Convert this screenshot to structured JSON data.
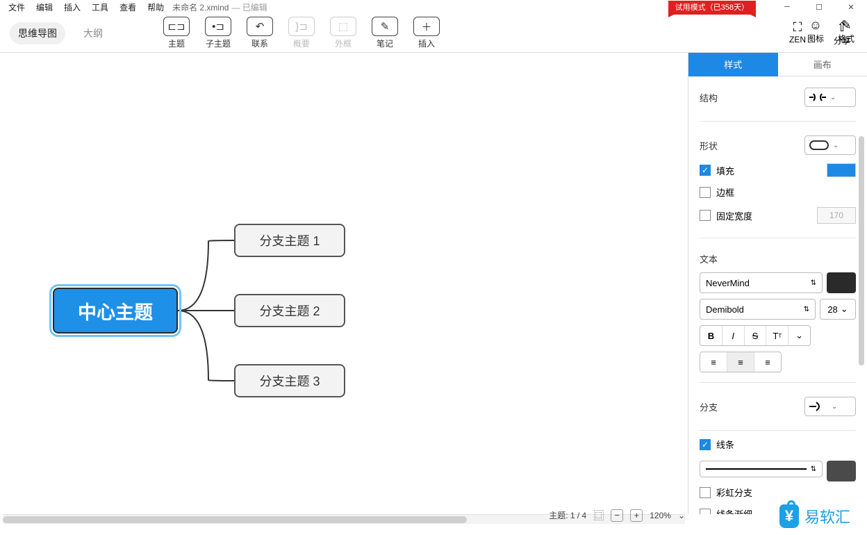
{
  "menu": {
    "items": [
      "文件",
      "编辑",
      "插入",
      "工具",
      "查看",
      "帮助"
    ]
  },
  "doc": {
    "title": "未命名 2.xmind",
    "status": "— 已编辑"
  },
  "trial": {
    "label": "试用模式（已358天）"
  },
  "viewTabs": {
    "mindmap": "思维导图",
    "outline": "大纲"
  },
  "toolbar": {
    "topic": "主题",
    "subtopic": "子主题",
    "relation": "联系",
    "summary": "概要",
    "boundary": "外框",
    "note": "笔记",
    "insert": "插入",
    "zen": "ZEN",
    "share": "分享",
    "icons": "图标",
    "format": "格式"
  },
  "nodes": {
    "central": "中心主题",
    "branch1": "分支主题 1",
    "branch2": "分支主题 2",
    "branch3": "分支主题 3"
  },
  "panel": {
    "tabs": {
      "style": "样式",
      "canvas": "画布"
    },
    "structure": "结构",
    "shape": "形状",
    "fill": "填充",
    "border": "边框",
    "fixedWidth": "固定宽度",
    "fixedWidthVal": "170",
    "text": "文本",
    "fontFamily": "NeverMind",
    "fontWeight": "Demibold",
    "fontSize": "28",
    "branch": "分支",
    "line": "线条",
    "rainbow": "彩虹分支",
    "tapered": "线条渐细",
    "fillColor": "#1e88e5",
    "textColor": "#2a2a2a",
    "lineColor": "#2a2a2a"
  },
  "status": {
    "topics": "主题: 1 / 4",
    "zoom": "120%",
    "caret": "⌄"
  },
  "watermark": {
    "text": "易软汇"
  }
}
